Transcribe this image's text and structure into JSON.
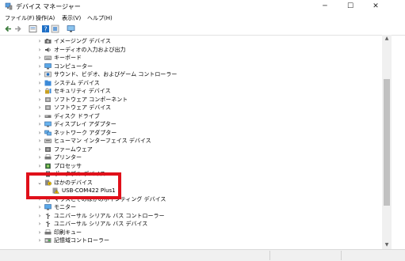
{
  "window": {
    "title": "デバイス マネージャー",
    "controls": {
      "minimize": "─",
      "maximize": "☐",
      "close": "✕"
    }
  },
  "menu": [
    "ファイル(F)",
    "操作(A)",
    "表示(V)",
    "ヘルプ(H)"
  ],
  "toolbar": {
    "buttons": [
      "back-icon",
      "forward-icon",
      "properties-icon",
      "help-icon",
      "update-icon",
      "monitor-icon"
    ]
  },
  "tree": {
    "items": [
      {
        "label": "イメージング デバイス",
        "icon": "camera-icon",
        "expanded": false
      },
      {
        "label": "オーディオの入力および出力",
        "icon": "speaker-icon",
        "expanded": false
      },
      {
        "label": "キーボード",
        "icon": "keyboard-icon",
        "expanded": false
      },
      {
        "label": "コンピューター",
        "icon": "computer-icon",
        "expanded": false
      },
      {
        "label": "サウンド、ビデオ、およびゲーム コントローラー",
        "icon": "sound-icon",
        "expanded": false
      },
      {
        "label": "システム デバイス",
        "icon": "system-folder-icon",
        "expanded": false
      },
      {
        "label": "セキュリティ デバイス",
        "icon": "security-icon",
        "expanded": false
      },
      {
        "label": "ソフトウェア コンポーネント",
        "icon": "component-icon",
        "expanded": false
      },
      {
        "label": "ソフトウェア デバイス",
        "icon": "software-device-icon",
        "expanded": false
      },
      {
        "label": "ディスク ドライブ",
        "icon": "disk-drive-icon",
        "expanded": false
      },
      {
        "label": "ディスプレイ アダプター",
        "icon": "display-adapter-icon",
        "expanded": false
      },
      {
        "label": "ネットワーク アダプター",
        "icon": "network-adapter-icon",
        "expanded": false
      },
      {
        "label": "ヒューマン インターフェイス デバイス",
        "icon": "hid-icon",
        "expanded": false
      },
      {
        "label": "ファームウェア",
        "icon": "firmware-icon",
        "expanded": false
      },
      {
        "label": "プリンター",
        "icon": "printer-icon",
        "expanded": false
      },
      {
        "label": "プロセッサ",
        "icon": "processor-icon",
        "expanded": false
      },
      {
        "label": "ポータブル デバイス",
        "icon": "portable-device-icon",
        "expanded": false
      },
      {
        "label": "ほかのデバイス",
        "icon": "other-devices-icon",
        "expanded": true
      },
      {
        "label": "USB-COM422 Plus1",
        "icon": "unknown-device-warning-icon",
        "child": true
      },
      {
        "label": "マウスとそのほかのポインティング デバイス",
        "icon": "mouse-icon",
        "expanded": false
      },
      {
        "label": "モニター",
        "icon": "monitor-icon",
        "expanded": false
      },
      {
        "label": "ユニバーサル シリアル バス コントローラー",
        "icon": "usb-controller-icon",
        "expanded": false
      },
      {
        "label": "ユニバーサル シリアル バス デバイス",
        "icon": "usb-device-icon",
        "expanded": false
      },
      {
        "label": "印刷キュー",
        "icon": "print-queue-icon",
        "expanded": false
      },
      {
        "label": "記憶域コントローラー",
        "icon": "storage-controller-icon",
        "expanded": false
      }
    ]
  },
  "colors": {
    "highlight": "#e0101a",
    "warning": "#f5c400",
    "accent": "#1e6fc6"
  }
}
